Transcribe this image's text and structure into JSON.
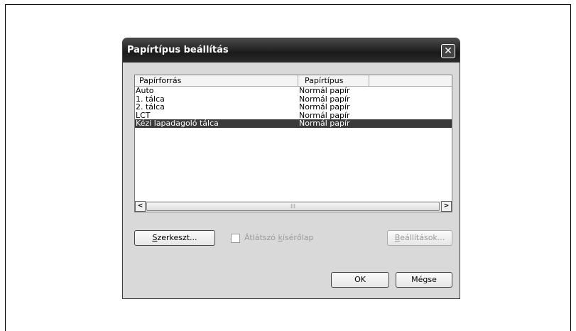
{
  "dialog": {
    "title": "Papírtípus beállítás",
    "close_symbol": "✕"
  },
  "list": {
    "columns": [
      "Papírforrás",
      "Papírtípus"
    ],
    "rows": [
      {
        "source": "Auto",
        "type": "Normál papír"
      },
      {
        "source": "1. tálca",
        "type": "Normál papír"
      },
      {
        "source": "2. tálca",
        "type": "Normál papír"
      },
      {
        "source": "LCT",
        "type": "Normál papír"
      },
      {
        "source": "Kézi lapadagoló tálca",
        "type": "Normál papír",
        "selected": true
      }
    ],
    "scroll_left": "<",
    "scroll_right": ">",
    "scroll_thumb_grip": "III"
  },
  "buttons": {
    "edit": {
      "accel": "S",
      "rest": "zerkeszt..."
    },
    "settings": {
      "accel": "B",
      "rest": "eállítások..."
    },
    "ok": "OK",
    "cancel": "Mégse"
  },
  "checkbox": {
    "label_before": "Átlátszó ",
    "accel": "k",
    "label_after": "ísérőlap",
    "checked": false,
    "enabled": false
  }
}
